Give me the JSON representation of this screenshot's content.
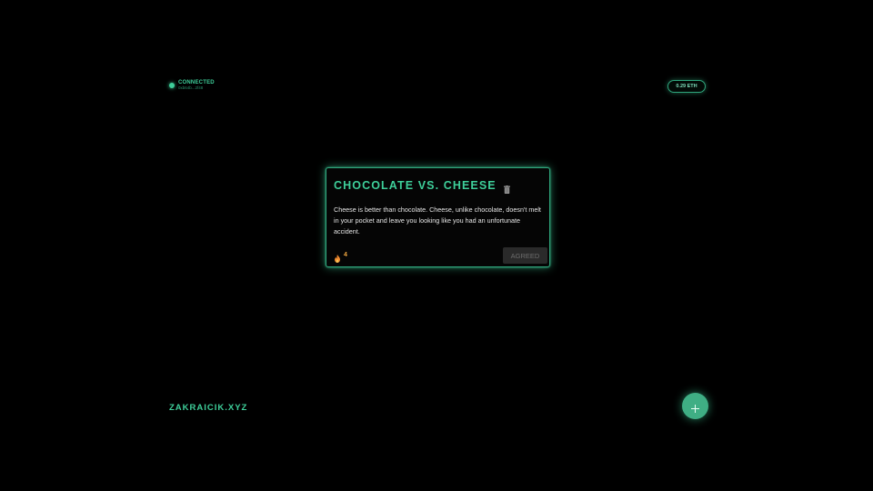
{
  "status": {
    "label": "CONNECTED",
    "sub": "0xb64b...2f48"
  },
  "balance": {
    "label": "0.29 ETH"
  },
  "card": {
    "title": "CHOCOLATE VS. CHEESE",
    "body": "Cheese is better than chocolate. Cheese, unlike chocolate, doesn't melt in your pocket and leave you looking like you had an unfortunate accident.",
    "fire_count": "4",
    "agree_label": "AGREED"
  },
  "footer": {
    "site_name": "ZAKRAICIK.XYZ"
  },
  "icons": {
    "status": "status-dot-icon",
    "delete": "trash-icon",
    "reactions": "fire-icon",
    "add": "plus-icon"
  },
  "colors": {
    "accent": "#3ecf9a",
    "background": "#000000",
    "fire": "#f0a640",
    "fab": "#3fae84"
  }
}
